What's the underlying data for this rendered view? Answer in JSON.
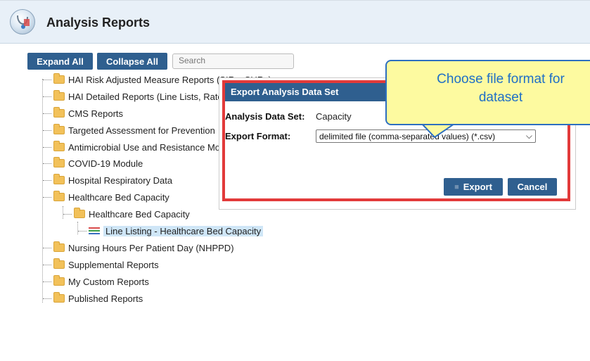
{
  "header": {
    "title": "Analysis Reports"
  },
  "toolbar": {
    "expand_all": "Expand All",
    "collapse_all": "Collapse All",
    "search_placeholder": "Search"
  },
  "tree": {
    "items": [
      "HAI Risk Adjusted Measure Reports (SIRs, SURs)",
      "HAI Detailed Reports (Line Lists, Rate Tables, etc.)",
      "CMS Reports",
      "Targeted Assessment for Prevention",
      "Antimicrobial Use and Resistance Module",
      "COVID-19 Module",
      "Hospital Respiratory Data",
      "Healthcare Bed Capacity",
      "Healthcare Bed Capacity",
      "Line Listing - Healthcare Bed Capacity",
      "Nursing Hours Per Patient Day (NHPPD)",
      "Supplemental Reports",
      "My Custom Reports",
      "Published Reports"
    ]
  },
  "dialog": {
    "title": "Export Analysis Data Set",
    "dataset_label": "Analysis Data Set:",
    "dataset_value": "Capacity",
    "format_label": "Export Format:",
    "format_value": "delimited file (comma-separated values) (*.csv)",
    "export": "Export",
    "cancel": "Cancel"
  },
  "callout": {
    "line1": "Choose file format for",
    "line2": "dataset"
  },
  "colors": {
    "accent": "#2f5f8f",
    "highlight_border": "#e23a3a",
    "callout_bg": "#fdfaa0",
    "callout_text": "#1f6fc6"
  }
}
